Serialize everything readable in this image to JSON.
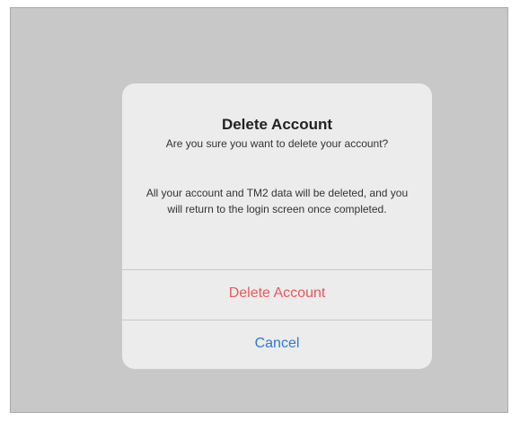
{
  "dialog": {
    "title": "Delete Account",
    "question": "Are you sure you want to delete your account?",
    "details": "All your account and TM2 data will be deleted, and you will return to the login screen once completed.",
    "buttons": {
      "delete_label": "Delete Account",
      "cancel_label": "Cancel"
    }
  },
  "colors": {
    "destructive": "#e8585e",
    "action": "#2f78d6",
    "backdrop": "#c8c8c8",
    "dialog_background": "#ececec"
  }
}
